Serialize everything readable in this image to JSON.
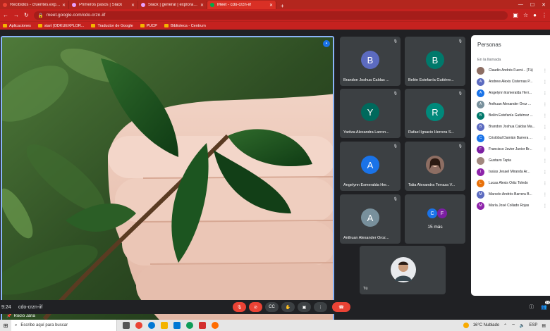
{
  "tabs": [
    {
      "label": "Recibidos - cfuentes.explora@gm",
      "color": "#ea4335",
      "active": false
    },
    {
      "label": "Primeros pasos | Slack",
      "color": "#e8a0ff",
      "active": false
    },
    {
      "label": "Slack | general | explora-arica",
      "color": "#e8a0ff",
      "active": false
    },
    {
      "label": "Meet - cdo-crzn-iif",
      "color": "#00ac47",
      "active": true
    }
  ],
  "address": "meet.google.com/cdo-crzn-iif",
  "bookmarks": [
    "Aplicaciones",
    "start [ODKUEXPLOR...",
    "Traductor de Google",
    "PUCP",
    "Biblioteca - Centrum"
  ],
  "main_video": {
    "name": "Rocío Jaña"
  },
  "tiles": [
    {
      "name": "Brandon Joshua Caldas ...",
      "initial": "B",
      "color": "#5c6bc0"
    },
    {
      "name": "Belén Estefanía Gutiérre...",
      "initial": "B",
      "color": "#00796b"
    },
    {
      "name": "Yaritza Alexandra Larron...",
      "initial": "Y",
      "color": "#00695c"
    },
    {
      "name": "Rafael Ignacio Herrera S...",
      "initial": "R",
      "color": "#00897b"
    },
    {
      "name": "Angelynn Esmeralda Her...",
      "initial": "A",
      "color": "#1a73e8"
    },
    {
      "name": "Talia Alexandra Terraza V...",
      "initial": "",
      "color": "#6d4c41"
    },
    {
      "name": "Anthuan Alexander Oroz...",
      "initial": "A",
      "color": "#78909c"
    }
  ],
  "more_tile": {
    "label": "15 más",
    "c1": "C",
    "c2": "F",
    "c1color": "#1a73e8",
    "c2color": "#7b1fa2"
  },
  "self_tile": {
    "name": "Tú"
  },
  "people_panel": {
    "title": "Personas",
    "subtitle": "En la llamada",
    "people": [
      {
        "name": "Claudio Andrés Fuent... (Tú)",
        "initial": "",
        "color": "#8d6e63"
      },
      {
        "name": "Andrew Alexis Cisternas P...",
        "initial": "A",
        "color": "#5c6bc0"
      },
      {
        "name": "Angelynn Esmeralda Herr...",
        "initial": "A",
        "color": "#1a73e8"
      },
      {
        "name": "Anthuan Alexander Oroz ...",
        "initial": "A",
        "color": "#78909c"
      },
      {
        "name": "Belén Estefanía Gutiérrez ...",
        "initial": "B",
        "color": "#00796b"
      },
      {
        "name": "Brandon Joshua Caldas Ma...",
        "initial": "B",
        "color": "#5c6bc0"
      },
      {
        "name": "Cristóbal Damián Barrera ...",
        "initial": "C",
        "color": "#1a73e8"
      },
      {
        "name": "Francisco Javier Junior Br...",
        "initial": "F",
        "color": "#7b1fa2"
      },
      {
        "name": "Gustavo Tapia",
        "initial": "",
        "color": "#a1887f"
      },
      {
        "name": "Isaías Jesael Miranda Ar...",
        "initial": "I",
        "color": "#8e24aa"
      },
      {
        "name": "Lucas Alexis Ortiz Toledo",
        "initial": "L",
        "color": "#e8710a"
      },
      {
        "name": "Marcelo Andrés Barrera B...",
        "initial": "M",
        "color": "#5c6bc0"
      },
      {
        "name": "María José Collado Rojas",
        "initial": "M",
        "color": "#8e24aa"
      }
    ]
  },
  "bottom": {
    "time": "9:24",
    "code": "cdo-crzn-iif",
    "participants_count": "24"
  },
  "taskbar": {
    "search_placeholder": "Escribe aquí para buscar",
    "weather": "16°C  Nublado",
    "lang": "ESP"
  }
}
